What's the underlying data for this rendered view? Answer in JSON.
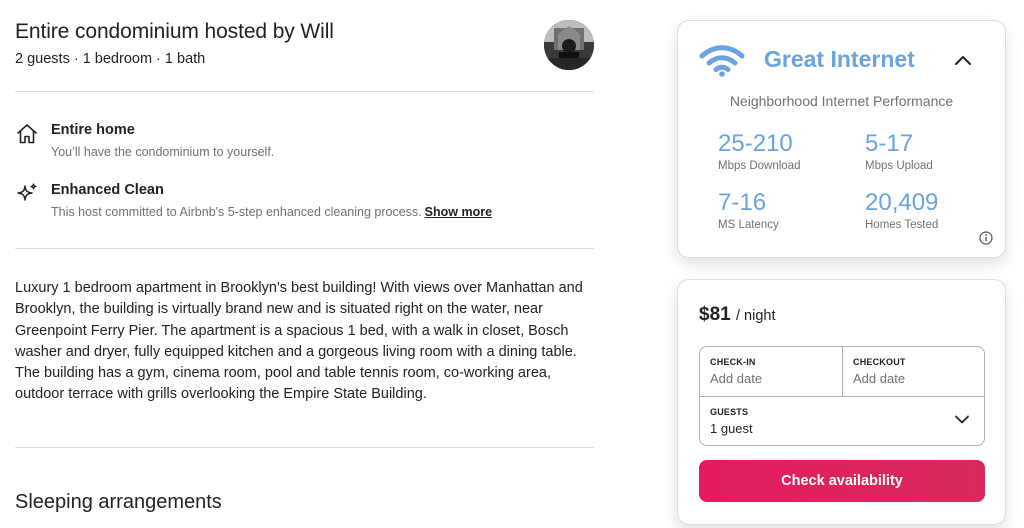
{
  "header": {
    "title": "Entire condominium hosted by Will",
    "subtitle": "2 guests · 1 bedroom · 1 bath"
  },
  "highlights": [
    {
      "icon": "home-icon",
      "title": "Entire home",
      "desc": "You’ll have the condominium to yourself."
    },
    {
      "icon": "sparkle-icon",
      "title": "Enhanced Clean",
      "desc": "This host committed to Airbnb's 5-step enhanced cleaning process.",
      "link": "Show more"
    }
  ],
  "description": "Luxury 1 bedroom apartment in Brooklyn's best building! With views over Manhattan and Brooklyn, the building is virtually brand new and is situated right on the water, near Greenpoint Ferry Pier. The apartment is a spacious 1 bed, with a walk in closet, Bosch washer and dryer, fully equipped kitchen and a gorgeous living room with a dining table. The building has a gym, cinema room, pool and table tennis room, co-working area, outdoor terrace with grills overlooking the Empire State Building.",
  "sleeping_title": "Sleeping arrangements",
  "internet": {
    "title": "Great Internet",
    "subtitle": "Neighborhood Internet Performance",
    "stats": [
      {
        "value": "25-210",
        "label": "Mbps Download"
      },
      {
        "value": "5-17",
        "label": "Mbps Upload"
      },
      {
        "value": "7-16",
        "label": "MS Latency"
      },
      {
        "value": "20,409",
        "label": "Homes Tested"
      }
    ],
    "accent_color": "#6aa3dd"
  },
  "booking": {
    "price": "$81",
    "per": "/ night",
    "checkin_label": "CHECK-IN",
    "checkin_placeholder": "Add date",
    "checkout_label": "CHECKOUT",
    "checkout_placeholder": "Add date",
    "guests_label": "GUESTS",
    "guests_value": "1 guest",
    "button": "Check availability",
    "button_color": "#e31c5f"
  }
}
